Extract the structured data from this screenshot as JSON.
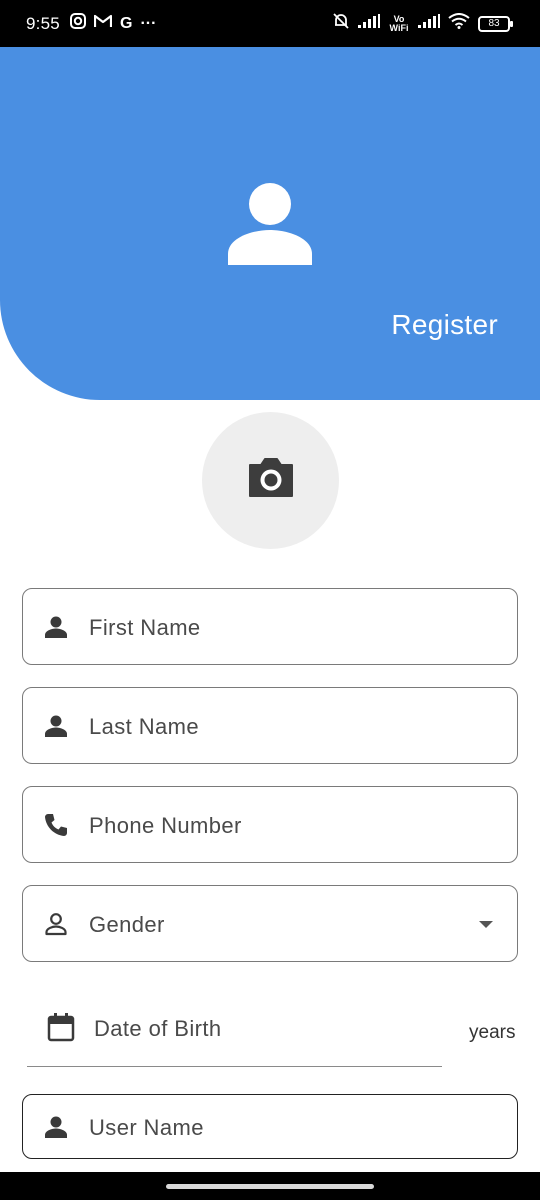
{
  "status_bar": {
    "time": "9:55",
    "left_icons": [
      "instagram-icon",
      "gmail-icon",
      "google-icon",
      "more-icon"
    ],
    "right_icons": [
      "mute-icon",
      "signal-icon",
      "vowifi-icon",
      "signal-icon",
      "wifi-icon"
    ],
    "vowifi_label": "Vo WiFi",
    "battery": "83"
  },
  "header": {
    "title": "Register",
    "color": "#4a8fe2"
  },
  "form": {
    "first_name_placeholder": "First Name",
    "last_name_placeholder": "Last Name",
    "phone_placeholder": "Phone Number",
    "gender_placeholder": "Gender",
    "dob_placeholder": "Date of Birth",
    "age_suffix": "years",
    "username_placeholder": "User Name"
  }
}
